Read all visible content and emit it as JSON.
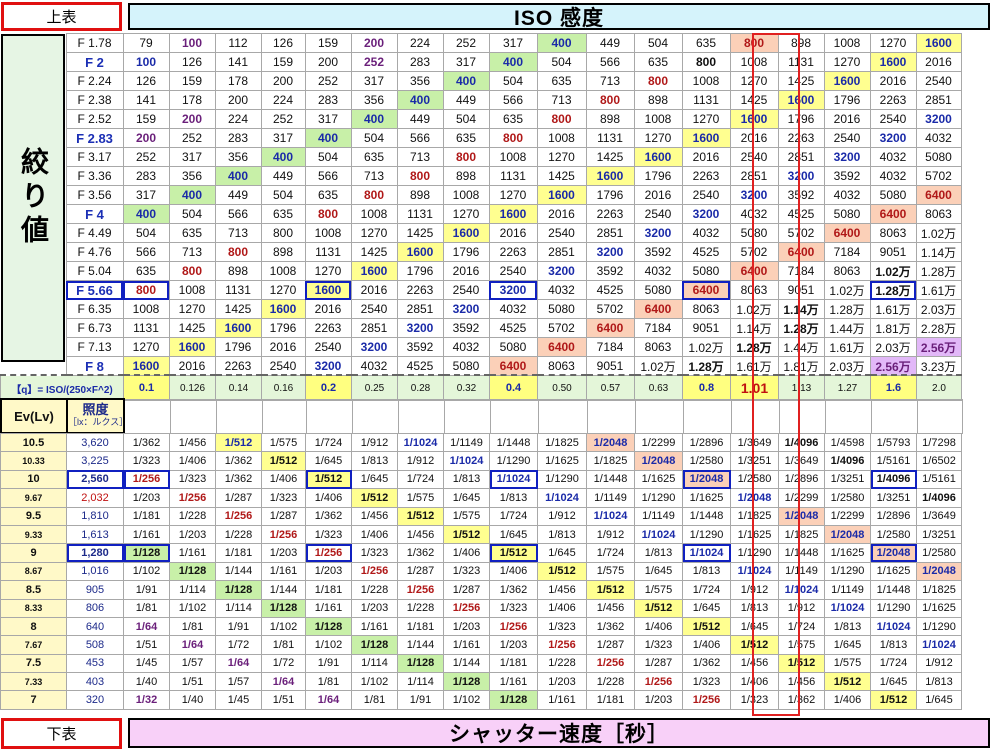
{
  "buttons": {
    "top": "上表",
    "bottom": "下表"
  },
  "titles": {
    "iso": "ISO 感度",
    "aperture": "絞り値",
    "shutter": "シャッター速度［秒］"
  },
  "fstops": [
    "F 1.78",
    "F 2",
    "F 2.24",
    "F 2.38",
    "F 2.52",
    "F 2.83",
    "F 3.17",
    "F 3.36",
    "F 3.56",
    "F 4",
    "F 4.49",
    "F 4.76",
    "F 5.04",
    "F 5.66",
    "F 6.35",
    "F 6.73",
    "F 7.13",
    "F 8"
  ],
  "iso_rows": [
    [
      "79",
      "100",
      "112",
      "126",
      "159",
      "200",
      "224",
      "252",
      "317",
      "400",
      "449",
      "504",
      "635",
      "800",
      "898",
      "1008",
      "1270",
      "1600"
    ],
    [
      "100",
      "126",
      "141",
      "159",
      "200",
      "252",
      "283",
      "317",
      "400",
      "504",
      "566",
      "635",
      "800",
      "1008",
      "1131",
      "1270",
      "1600",
      "2016"
    ],
    [
      "126",
      "159",
      "178",
      "200",
      "252",
      "317",
      "356",
      "400",
      "504",
      "635",
      "713",
      "800",
      "1008",
      "1270",
      "1425",
      "1600",
      "2016",
      "2540"
    ],
    [
      "141",
      "178",
      "200",
      "224",
      "283",
      "356",
      "400",
      "449",
      "566",
      "713",
      "800",
      "898",
      "1131",
      "1425",
      "1600",
      "1796",
      "2263",
      "2851"
    ],
    [
      "159",
      "200",
      "224",
      "252",
      "317",
      "400",
      "449",
      "504",
      "635",
      "800",
      "898",
      "1008",
      "1270",
      "1600",
      "1796",
      "2016",
      "2540",
      "3200"
    ],
    [
      "200",
      "252",
      "283",
      "317",
      "400",
      "504",
      "566",
      "635",
      "800",
      "1008",
      "1131",
      "1270",
      "1600",
      "2016",
      "2263",
      "2540",
      "3200",
      "4032"
    ],
    [
      "252",
      "317",
      "356",
      "400",
      "504",
      "635",
      "713",
      "800",
      "1008",
      "1270",
      "1425",
      "1600",
      "2016",
      "2540",
      "2851",
      "3200",
      "4032",
      "5080"
    ],
    [
      "283",
      "356",
      "400",
      "449",
      "566",
      "713",
      "800",
      "898",
      "1131",
      "1425",
      "1600",
      "1796",
      "2263",
      "2851",
      "3200",
      "3592",
      "4032",
      "5702"
    ],
    [
      "317",
      "400",
      "449",
      "504",
      "635",
      "800",
      "898",
      "1008",
      "1270",
      "1600",
      "1796",
      "2016",
      "2540",
      "3200",
      "3592",
      "4032",
      "5080",
      "6400"
    ],
    [
      "400",
      "504",
      "566",
      "635",
      "800",
      "1008",
      "1131",
      "1270",
      "1600",
      "2016",
      "2263",
      "2540",
      "3200",
      "4032",
      "4525",
      "5080",
      "6400",
      "8063"
    ],
    [
      "504",
      "635",
      "713",
      "800",
      "1008",
      "1270",
      "1425",
      "1600",
      "2016",
      "2540",
      "2851",
      "3200",
      "4032",
      "5080",
      "5702",
      "6400",
      "8063",
      "1.02万"
    ],
    [
      "566",
      "713",
      "800",
      "898",
      "1131",
      "1425",
      "1600",
      "1796",
      "2263",
      "2851",
      "3200",
      "3592",
      "4525",
      "5702",
      "6400",
      "7184",
      "9051",
      "1.14万"
    ],
    [
      "635",
      "800",
      "898",
      "1008",
      "1270",
      "1600",
      "1796",
      "2016",
      "2540",
      "3200",
      "3592",
      "4032",
      "5080",
      "6400",
      "7184",
      "8063",
      "1.02万",
      "1.28万"
    ],
    [
      "800",
      "1008",
      "1131",
      "1270",
      "1600",
      "2016",
      "2263",
      "2540",
      "3200",
      "4032",
      "4525",
      "5080",
      "6400",
      "8063",
      "9051",
      "1.02万",
      "1.28万",
      "1.61万"
    ],
    [
      "1008",
      "1270",
      "1425",
      "1600",
      "2016",
      "2540",
      "2851",
      "3200",
      "4032",
      "5080",
      "5702",
      "6400",
      "8063",
      "1.02万",
      "1.14万",
      "1.28万",
      "1.61万",
      "2.03万"
    ],
    [
      "1131",
      "1425",
      "1600",
      "1796",
      "2263",
      "2851",
      "3200",
      "3592",
      "4525",
      "5702",
      "6400",
      "7184",
      "9051",
      "1.14万",
      "1.28万",
      "1.44万",
      "1.81万",
      "2.28万"
    ],
    [
      "1270",
      "1600",
      "1796",
      "2016",
      "2540",
      "3200",
      "3592",
      "4032",
      "5080",
      "6400",
      "7184",
      "8063",
      "1.02万",
      "1.28万",
      "1.44万",
      "1.61万",
      "2.03万",
      "2.56万"
    ],
    [
      "1600",
      "2016",
      "2263",
      "2540",
      "3200",
      "4032",
      "4525",
      "5080",
      "6400",
      "8063",
      "9051",
      "1.02万",
      "1.28万",
      "1.61万",
      "1.81万",
      "2.03万",
      "2.56万",
      "3.23万"
    ]
  ],
  "q_label": "【q】= ISO/(250×F^2)",
  "q_values": [
    "0.1",
    "0.126",
    "0.14",
    "0.16",
    "0.2",
    "0.25",
    "0.28",
    "0.32",
    "0.4",
    "0.50",
    "0.57",
    "0.63",
    "0.8",
    "1.01",
    "1.13",
    "1.27",
    "1.6",
    "2.0"
  ],
  "ev_header": "Ev(Lv)",
  "lux_header": "照度",
  "lux_unit": "［lx：ルクス］",
  "ev_rows": [
    {
      "ev": "10.5",
      "lux": "3,620",
      "cells": [
        "1/362",
        "1/456",
        "1/512",
        "1/575",
        "1/724",
        "1/912",
        "1/1024",
        "1/1149",
        "1/1448",
        "1/1825",
        "1/2048",
        "1/2299",
        "1/2896",
        "1/3649",
        "1/4096",
        "1/4598",
        "1/5793",
        "1/7298"
      ]
    },
    {
      "ev": "10.33",
      "lux": "3,225",
      "cells": [
        "1/323",
        "1/406",
        "1/362",
        "1/512",
        "1/645",
        "1/813",
        "1/912",
        "1/1024",
        "1/1290",
        "1/1625",
        "1/1825",
        "1/2048",
        "1/2580",
        "1/3251",
        "1/3649",
        "1/4096",
        "1/5161",
        "1/6502"
      ]
    },
    {
      "ev": "10",
      "lux": "2,560",
      "cells": [
        "1/256",
        "1/323",
        "1/362",
        "1/406",
        "1/512",
        "1/645",
        "1/724",
        "1/813",
        "1/1024",
        "1/1290",
        "1/1448",
        "1/1625",
        "1/2048",
        "1/2580",
        "1/2896",
        "1/3251",
        "1/4096",
        "1/5161"
      ]
    },
    {
      "ev": "9.67",
      "lux": "2,032",
      "cells": [
        "1/203",
        "1/256",
        "1/287",
        "1/323",
        "1/406",
        "1/512",
        "1/575",
        "1/645",
        "1/813",
        "1/1024",
        "1/1149",
        "1/1290",
        "1/1625",
        "1/2048",
        "1/2299",
        "1/2580",
        "1/3251",
        "1/4096"
      ]
    },
    {
      "ev": "9.5",
      "lux": "1,810",
      "cells": [
        "1/181",
        "1/228",
        "1/256",
        "1/287",
        "1/362",
        "1/456",
        "1/512",
        "1/575",
        "1/724",
        "1/912",
        "1/1024",
        "1/1149",
        "1/1448",
        "1/1825",
        "1/2048",
        "1/2299",
        "1/2896",
        "1/3649"
      ]
    },
    {
      "ev": "9.33",
      "lux": "1,613",
      "cells": [
        "1/161",
        "1/203",
        "1/228",
        "1/256",
        "1/323",
        "1/406",
        "1/456",
        "1/512",
        "1/645",
        "1/813",
        "1/912",
        "1/1024",
        "1/1290",
        "1/1625",
        "1/1825",
        "1/2048",
        "1/2580",
        "1/3251"
      ]
    },
    {
      "ev": "9",
      "lux": "1,280",
      "cells": [
        "1/128",
        "1/161",
        "1/181",
        "1/203",
        "1/256",
        "1/323",
        "1/362",
        "1/406",
        "1/512",
        "1/645",
        "1/724",
        "1/813",
        "1/1024",
        "1/1290",
        "1/1448",
        "1/1625",
        "1/2048",
        "1/2580"
      ]
    },
    {
      "ev": "8.67",
      "lux": "1,016",
      "cells": [
        "1/102",
        "1/128",
        "1/144",
        "1/161",
        "1/203",
        "1/256",
        "1/287",
        "1/323",
        "1/406",
        "1/512",
        "1/575",
        "1/645",
        "1/813",
        "1/1024",
        "1/1149",
        "1/1290",
        "1/1625",
        "1/2048"
      ]
    },
    {
      "ev": "8.5",
      "lux": "905",
      "cells": [
        "1/91",
        "1/114",
        "1/128",
        "1/144",
        "1/181",
        "1/228",
        "1/256",
        "1/287",
        "1/362",
        "1/456",
        "1/512",
        "1/575",
        "1/724",
        "1/912",
        "1/1024",
        "1/1149",
        "1/1448",
        "1/1825"
      ]
    },
    {
      "ev": "8.33",
      "lux": "806",
      "cells": [
        "1/81",
        "1/102",
        "1/114",
        "1/128",
        "1/161",
        "1/203",
        "1/228",
        "1/256",
        "1/323",
        "1/406",
        "1/456",
        "1/512",
        "1/645",
        "1/813",
        "1/912",
        "1/1024",
        "1/1290",
        "1/1625"
      ]
    },
    {
      "ev": "8",
      "lux": "640",
      "cells": [
        "1/64",
        "1/81",
        "1/91",
        "1/102",
        "1/128",
        "1/161",
        "1/181",
        "1/203",
        "1/256",
        "1/323",
        "1/362",
        "1/406",
        "1/512",
        "1/645",
        "1/724",
        "1/813",
        "1/1024",
        "1/1290"
      ]
    },
    {
      "ev": "7.67",
      "lux": "508",
      "cells": [
        "1/51",
        "1/64",
        "1/72",
        "1/81",
        "1/102",
        "1/128",
        "1/144",
        "1/161",
        "1/203",
        "1/256",
        "1/287",
        "1/323",
        "1/406",
        "1/512",
        "1/575",
        "1/645",
        "1/813",
        "1/1024"
      ]
    },
    {
      "ev": "7.5",
      "lux": "453",
      "cells": [
        "1/45",
        "1/57",
        "1/64",
        "1/72",
        "1/91",
        "1/114",
        "1/128",
        "1/144",
        "1/181",
        "1/228",
        "1/256",
        "1/287",
        "1/362",
        "1/456",
        "1/512",
        "1/575",
        "1/724",
        "1/912"
      ]
    },
    {
      "ev": "7.33",
      "lux": "403",
      "cells": [
        "1/40",
        "1/51",
        "1/57",
        "1/64",
        "1/81",
        "1/102",
        "1/114",
        "1/128",
        "1/161",
        "1/203",
        "1/228",
        "1/256",
        "1/323",
        "1/406",
        "1/456",
        "1/512",
        "1/645",
        "1/813"
      ]
    },
    {
      "ev": "7",
      "lux": "320",
      "cells": [
        "1/32",
        "1/40",
        "1/45",
        "1/51",
        "1/64",
        "1/81",
        "1/91",
        "1/102",
        "1/128",
        "1/161",
        "1/181",
        "1/203",
        "1/256",
        "1/323",
        "1/362",
        "1/406",
        "1/512",
        "1/645"
      ]
    }
  ],
  "colors": {
    "accent_red": "#e01010",
    "header_bg": "#d5f3fb",
    "shutter_bg": "#f8d0f8",
    "q_bg": "#e4f6d9",
    "highlight_green": "#c8f0a8",
    "highlight_yellow": "#ffff90",
    "highlight_orange": "#fbd0b8",
    "highlight_violet": "#e2b8f8"
  }
}
